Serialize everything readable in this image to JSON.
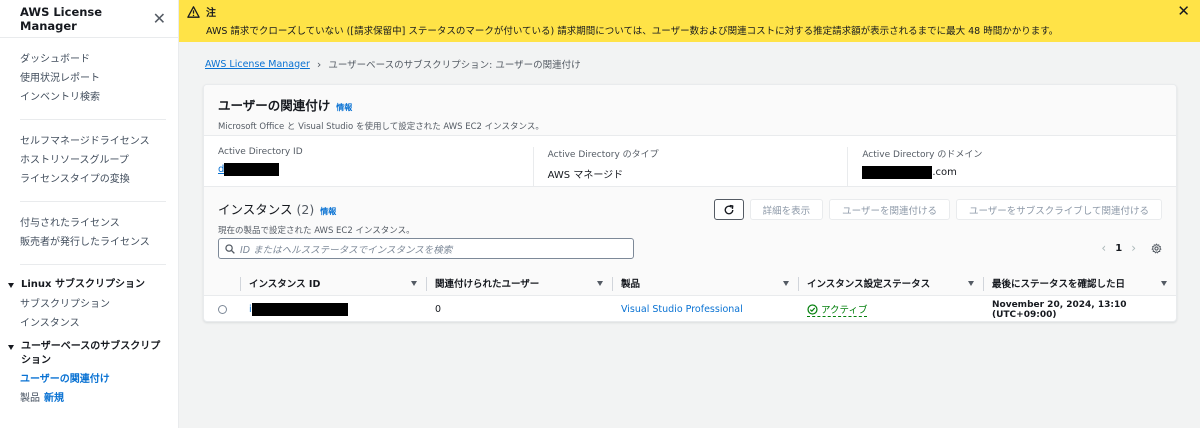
{
  "sidebar": {
    "title": "AWS License Manager",
    "close": "✕",
    "group1": [
      "ダッシュボード",
      "使用状況レポート",
      "インベントリ検索"
    ],
    "group2": [
      "セルフマネージドライセンス",
      "ホストリソースグループ",
      "ライセンスタイプの変換"
    ],
    "group3": [
      "付与されたライセンス",
      "販売者が発行したライセンス"
    ],
    "linux": {
      "title": "Linux サブスクリプション",
      "items": [
        "サブスクリプション",
        "インスタンス"
      ]
    },
    "userbased": {
      "title": "ユーザーベースのサブスクリプション",
      "items": [
        "ユーザーの関連付け",
        "製品"
      ],
      "new_badge": "新規"
    }
  },
  "banner": {
    "title": "注",
    "text": "AWS 請求でクローズしていない ([請求保留中] ステータスのマークが付いている) 請求期間については、ユーザー数および関連コストに対する推定請求額が表示されるまでに最大 48 時間かかります。",
    "close": "✕"
  },
  "breadcrumb": {
    "root": "AWS License Manager",
    "current": "ユーザーベースのサブスクリプション: ユーザーの関連付け"
  },
  "details": {
    "title": "ユーザーの関連付け",
    "info": "情報",
    "description": "Microsoft Office と Visual Studio を使用して設定された AWS EC2 インスタンス。",
    "ad_id_label": "Active Directory ID",
    "ad_id_prefix": "d",
    "ad_type_label": "Active Directory のタイプ",
    "ad_type_value": "AWS マネージド",
    "ad_domain_label": "Active Directory のドメイン",
    "ad_domain_suffix": ".com"
  },
  "instances": {
    "title": "インスタンス",
    "count": "(2)",
    "info": "情報",
    "description": "現在の製品で設定された AWS EC2 インスタンス。",
    "buttons": {
      "details": "詳細を表示",
      "associate": "ユーザーを関連付ける",
      "subscribe": "ユーザーをサブスクライブして関連付ける"
    },
    "search_placeholder": "ID またはヘルスステータスでインスタンスを検索",
    "page": "1",
    "columns": [
      "インスタンス ID",
      "関連付けられたユーザー",
      "製品",
      "インスタンス設定ステータス",
      "最後にステータスを確認した日"
    ],
    "rows": [
      {
        "id_prefix": "i",
        "users": "0",
        "product": "Visual Studio Professional",
        "status": "アクティブ",
        "last_checked": "November 20, 2024, 13:10 (UTC+09:00)"
      }
    ]
  },
  "colors": {
    "link": "#0972d3",
    "success": "#037f0c",
    "banner": "#ffe347"
  }
}
